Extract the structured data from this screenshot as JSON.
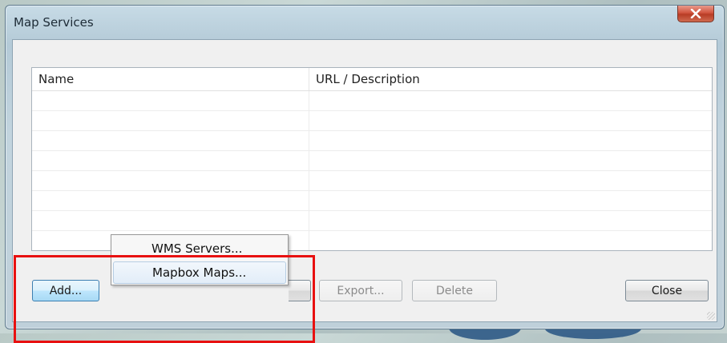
{
  "window": {
    "title": "Map Services",
    "close_icon": "close-icon",
    "accent_close": "#c8452c"
  },
  "table": {
    "columns": [
      {
        "label": "Name"
      },
      {
        "label": "URL / Description"
      }
    ],
    "rows": [
      {
        "name": "",
        "url": ""
      },
      {
        "name": "",
        "url": ""
      },
      {
        "name": "",
        "url": ""
      },
      {
        "name": "",
        "url": ""
      },
      {
        "name": "",
        "url": ""
      },
      {
        "name": "",
        "url": ""
      },
      {
        "name": "",
        "url": ""
      },
      {
        "name": "",
        "url": ""
      }
    ]
  },
  "buttons": {
    "add": "Add...",
    "export": "Export...",
    "delete": "Delete",
    "close": "Close"
  },
  "add_menu": {
    "items": [
      {
        "label": "WMS Servers..."
      },
      {
        "label": "Mapbox Maps...",
        "hovered": true
      }
    ]
  },
  "annotation": {
    "color": "#e81010"
  }
}
